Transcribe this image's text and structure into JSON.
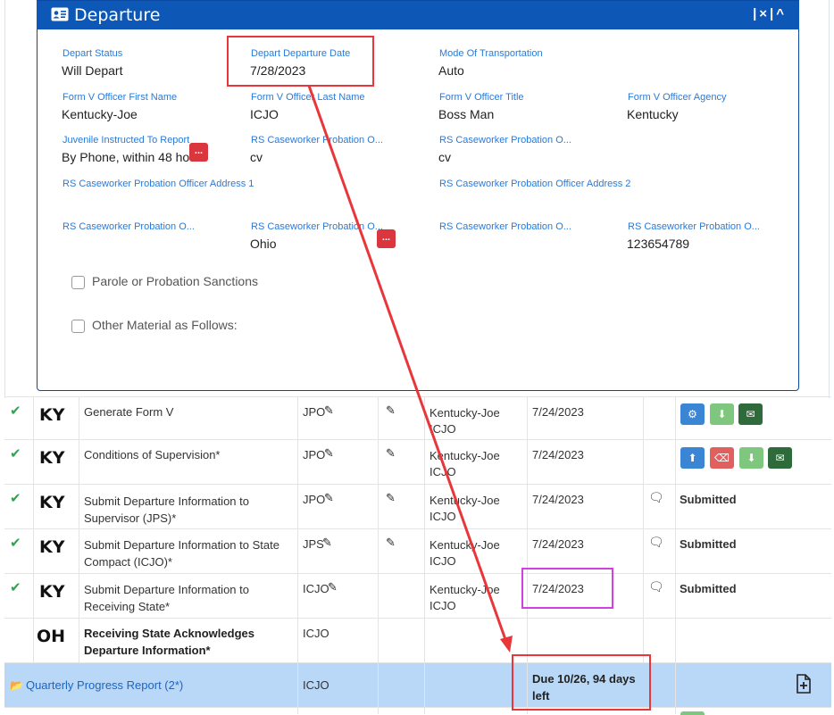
{
  "panel": {
    "title": "Departure",
    "controls": {
      "separator": "|",
      "close": "×",
      "collapse": "^"
    }
  },
  "fields": {
    "depart_status": {
      "label": "Depart Status",
      "value": "Will Depart"
    },
    "depart_date": {
      "label": "Depart Departure Date",
      "value": "7/28/2023"
    },
    "mode": {
      "label": "Mode Of Transportation",
      "value": "Auto"
    },
    "officer_first": {
      "label": "Form V Officer First Name",
      "value": "Kentucky-Joe"
    },
    "officer_last": {
      "label": "Form V Officer Last Name",
      "value": "ICJO"
    },
    "officer_title": {
      "label": "Form V Officer Title",
      "value": "Boss Man"
    },
    "officer_agency": {
      "label": "Form V Officer Agency",
      "value": "Kentucky"
    },
    "juvenile_instructed": {
      "label": "Juvenile Instructed To Report",
      "value": "By Phone, within 48 hours"
    },
    "rs_caseworker_1": {
      "label": "RS Caseworker Probation O...",
      "value": "cv"
    },
    "rs_caseworker_2": {
      "label": "RS Caseworker Probation O...",
      "value": "cv"
    },
    "rs_address_1": {
      "label": "RS Caseworker Probation Officer Address 1",
      "value": ""
    },
    "rs_address_2": {
      "label": "RS Caseworker Probation Officer Address 2",
      "value": ""
    },
    "rs_city": {
      "label": "RS Caseworker Probation O...",
      "value": ""
    },
    "rs_state": {
      "label": "RS Caseworker Probation O...",
      "value": "Ohio"
    },
    "rs_zip": {
      "label": "RS Caseworker Probation O...",
      "value": ""
    },
    "rs_phone": {
      "label": "RS Caseworker Probation O...",
      "value": "123654789"
    }
  },
  "checkboxes": {
    "sanctions": "Parole or Probation Sanctions",
    "other_material": "Other Material as Follows:"
  },
  "more_icon": "...",
  "rows": [
    {
      "state": "KY",
      "task": "Generate Form V",
      "role": "JPO",
      "person": "Kentucky-Joe ICJO",
      "date": "7/24/2023",
      "status": ""
    },
    {
      "state": "KY",
      "task": "Conditions of Supervision*",
      "role": "JPO",
      "person": "Kentucky-Joe ICJO",
      "date": "7/24/2023",
      "status": ""
    },
    {
      "state": "KY",
      "task": "Submit Departure Information to Supervisor (JPS)*",
      "role": "JPO",
      "person": "Kentucky-Joe ICJO",
      "date": "7/24/2023",
      "status": "Submitted"
    },
    {
      "state": "KY",
      "task": "Submit Departure Information to State Compact (ICJO)*",
      "role": "JPS",
      "person": "Kentucky-Joe ICJO",
      "date": "7/24/2023",
      "status": "Submitted"
    },
    {
      "state": "KY",
      "task": "Submit Departure Information to Receiving State*",
      "role": "ICJO",
      "person": "Kentucky-Joe ICJO",
      "date": "7/24/2023",
      "status": "Submitted"
    },
    {
      "state": "OH",
      "task": "Receiving State Acknowledges Departure Information*",
      "role": "ICJO",
      "person": "",
      "date": "",
      "status": ""
    }
  ],
  "quarterly": {
    "label": "Quarterly Progress Report (2*)",
    "role": "ICJO",
    "due": "Due 10/26, 94 days left"
  },
  "colors": {
    "header_blue": "#0d57b6",
    "label_blue": "#2a7ad8",
    "highlight_red": "#e8363a",
    "highlight_magenta": "#d440e0",
    "check_green": "#2ea44f",
    "btn_blue": "#3a86d4",
    "btn_green": "#7fc77f",
    "btn_dark_green": "#2f6b3a",
    "btn_red": "#e06060"
  }
}
